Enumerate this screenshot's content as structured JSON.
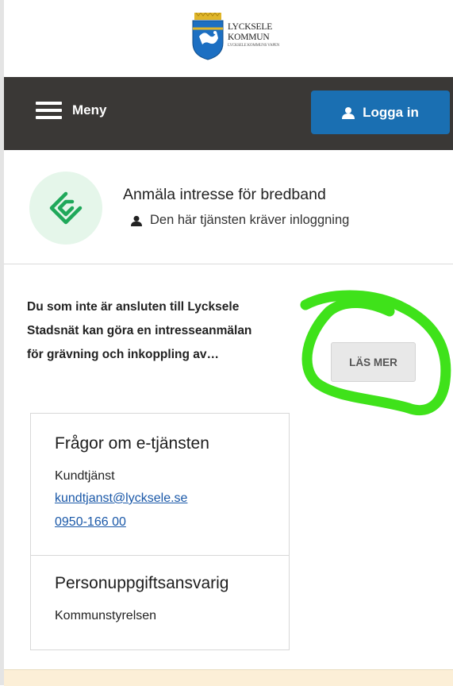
{
  "logo": {
    "line1": "LYCKSELE",
    "line2": "KOMMUN",
    "line3": "LYCKSELE KOMMUNS VAPEN"
  },
  "topbar": {
    "menu_label": "Meny",
    "login_label": "Logga in"
  },
  "service": {
    "title": "Anmäla intresse för bredband",
    "requirement": "Den här tjänsten kräver inloggning"
  },
  "description": {
    "line1": "Du som inte är ansluten till Lycksele",
    "line2": "Stadsnät kan göra en intresseanmälan",
    "line3": "för grävning och inkoppling av…",
    "read_more_label": "LÄS MER"
  },
  "contact": {
    "heading": "Frågor om e-tjänsten",
    "name": "Kundtjänst",
    "email": "kundtjanst@lycksele.se",
    "phone": "0950-166 00"
  },
  "data_controller": {
    "heading": "Personuppgiftsansvarig",
    "value": "Kommunstyrelsen"
  },
  "colors": {
    "header_bg": "#3a3836",
    "login_button": "#1a6fb2",
    "icon_bg": "#e5f6ea",
    "icon_green": "#1fa85a",
    "annotation_green": "#3fe21a",
    "link": "#1a58a8"
  },
  "icons": [
    "menu-icon",
    "user-icon",
    "broadband-service-icon"
  ]
}
